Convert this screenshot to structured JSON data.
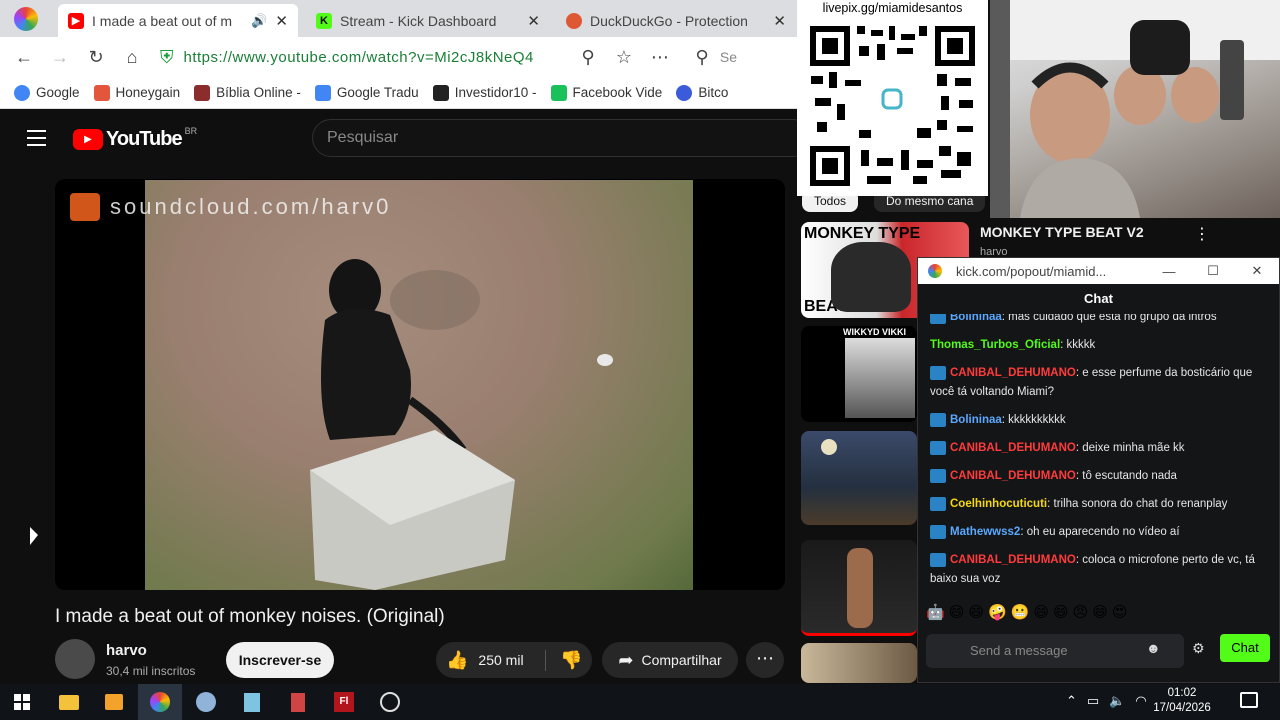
{
  "browser": {
    "tabs": [
      {
        "title": "I made a beat out of m",
        "favicon_color": "#ff0000",
        "active": true
      },
      {
        "title": "Stream - Kick Dashboard",
        "favicon_color": "#53fc18",
        "favicon_letter": "K"
      },
      {
        "title": "DuckDuckGo - Protection",
        "favicon_color": "#de5833"
      }
    ],
    "url": "https://www.youtube.com/watch?v=Mi2cJ8kNeQ4",
    "search_partial": "Se",
    "bookmarks": [
      {
        "label": "Google",
        "color": "#4285f4"
      },
      {
        "label": "Honeygain",
        "color": "#e2573c"
      },
      {
        "label": "Bíblia Online -",
        "color": "#8b2d2d"
      },
      {
        "label": "Google Tradu",
        "color": "#4285f4"
      },
      {
        "label": "Investidor10 -",
        "color": "#222222"
      },
      {
        "label": "Facebook Vide",
        "color": "#1ac15b"
      },
      {
        "label": "Bitco",
        "color": "#3b5bdb"
      }
    ]
  },
  "youtube": {
    "logo_text": "YouTube",
    "country": "BR",
    "search_placeholder": "Pesquisar",
    "video_watermark": "soundcloud.com/harv0",
    "video_title": "I made a beat out of monkey noises. (Original)",
    "channel_name": "harvo",
    "channel_subs": "30,4 mil inscritos",
    "subscribe_label": "Inscrever-se",
    "likes": "250 mil",
    "share_label": "Compartilhar",
    "sidebar": {
      "chip_1": "Todos",
      "chip_2": "Do mesmo cana",
      "first_title": "MONKEY TYPE BEAT V2",
      "first_channel": "harvo",
      "thumb_text_top": "MONKEY TYPE",
      "thumb_text_bottom": "BEAT",
      "thumb2_text": "WIKKYD VIKKI"
    }
  },
  "stream_overlay": {
    "qr_label": "livepix.gg/miamidesantos"
  },
  "chat": {
    "window_url": "kick.com/popout/miamid...",
    "header": "Chat",
    "messages": [
      {
        "user": "Bolininaa",
        "color": "#5aa8ff",
        "text": ": mas cuidado que esta no grupo da intros",
        "badge": true
      },
      {
        "user": "Thomas_Turbos_Oficial",
        "color": "#53fc18",
        "text": ": kkkkk",
        "badge": false
      },
      {
        "user": "CANIBAL_DEHUMANO",
        "color": "#ff3b3b",
        "text": ": e esse perfume da bosticário que você tá voltando Miami?",
        "badge": true
      },
      {
        "user": "Bolininaa",
        "color": "#5aa8ff",
        "text": ": kkkkkkkkkk",
        "badge": true
      },
      {
        "user": "CANIBAL_DEHUMANO",
        "color": "#ff3b3b",
        "text": ": deixe minha mãe kk",
        "badge": true
      },
      {
        "user": "CANIBAL_DEHUMANO",
        "color": "#ff3b3b",
        "text": ": tô escutando nada",
        "badge": true
      },
      {
        "user": "Coelhinhocuticuti",
        "color": "#f5d90a",
        "text": ": trilha sonora do chat do renanplay",
        "badge": true
      },
      {
        "user": "Mathewwss2",
        "color": "#5aa8ff",
        "text": ": oh eu aparecendo no vídeo aí",
        "badge": true
      },
      {
        "user": "CANIBAL_DEHUMANO",
        "color": "#ff3b3b",
        "text": ": coloca o microfone perto de vc, tá baixo sua voz",
        "badge": true
      }
    ],
    "emotes": [
      "🤖",
      "😄",
      "😄",
      "🤪",
      "😬",
      "😄",
      "😄",
      "😠",
      "😄",
      "😍"
    ],
    "input_placeholder": "Send a message",
    "send_label": "Chat"
  },
  "taskbar": {
    "time": "01:02",
    "date": "17/04/2026"
  }
}
